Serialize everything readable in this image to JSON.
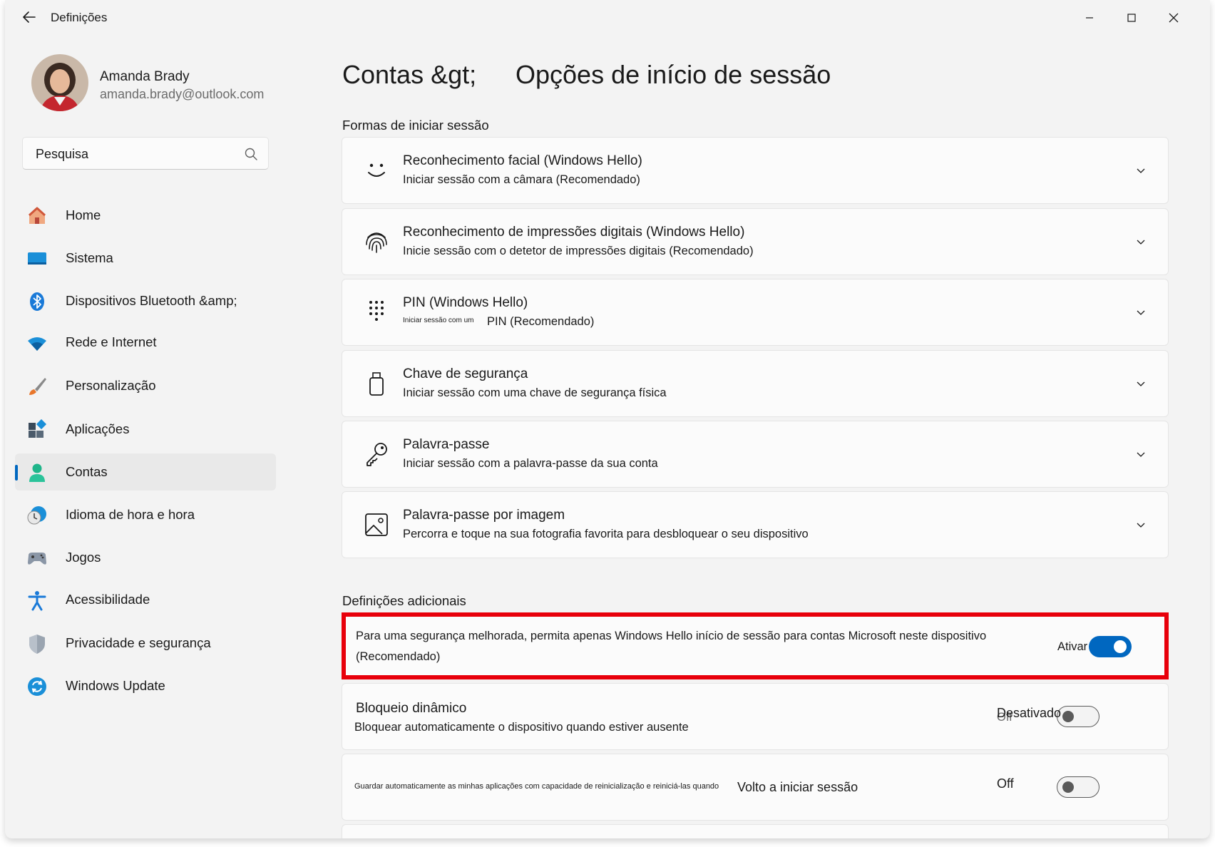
{
  "window": {
    "title": "Definições"
  },
  "user": {
    "name": "Amanda Brady",
    "email": "amanda.brady@outlook.com"
  },
  "search": {
    "placeholder": "Pesquisa"
  },
  "sidebar": {
    "items": [
      {
        "label": "Home",
        "icon": "home-icon"
      },
      {
        "label": "Sistema",
        "icon": "system-icon"
      },
      {
        "label": "Dispositivos Bluetooth &amp;",
        "icon": "bluetooth-icon"
      },
      {
        "label": "Rede e Internet",
        "icon": "wifi-icon"
      },
      {
        "label": "Personalização",
        "icon": "brush-icon"
      },
      {
        "label": "Aplicações",
        "icon": "apps-icon"
      },
      {
        "label": "Contas",
        "icon": "accounts-icon",
        "active": true
      },
      {
        "label": "Idioma de hora e hora",
        "icon": "time-language-icon"
      },
      {
        "label": "Jogos",
        "icon": "gaming-icon"
      },
      {
        "label": "Acessibilidade",
        "icon": "accessibility-icon"
      },
      {
        "label": "Privacidade e segurança",
        "icon": "shield-icon"
      },
      {
        "label": "Windows Update",
        "icon": "update-icon"
      }
    ]
  },
  "header": {
    "breadcrumb_parent": "Contas &gt;",
    "title": "Opções de início de sessão"
  },
  "sign_in_section": {
    "title": "Formas de iniciar sessão",
    "cards": [
      {
        "title": "Reconhecimento facial (Windows Hello)",
        "subtitle": "Iniciar sessão com a câmara (Recomendado)",
        "icon": "face-icon"
      },
      {
        "title": "Reconhecimento de impressões digitais (Windows Hello)",
        "subtitle": "Inicie sessão com o detetor de impressões digitais (Recomendado)",
        "icon": "fingerprint-icon"
      },
      {
        "title": "PIN (Windows Hello)",
        "subtitle_small": "Iniciar sessão com um",
        "subtitle": "PIN (Recomendado)",
        "icon": "pin-keypad-icon"
      },
      {
        "title": "Chave de segurança",
        "subtitle": "Iniciar sessão com uma chave de segurança física",
        "icon": "usb-key-icon"
      },
      {
        "title": "Palavra-passe",
        "subtitle": "Iniciar sessão com a palavra-passe da sua conta",
        "icon": "key-icon"
      },
      {
        "title": "Palavra-passe por imagem",
        "subtitle": "Percorra e toque na sua fotografia favorita para desbloquear o seu dispositivo",
        "icon": "picture-icon"
      }
    ]
  },
  "additional_section": {
    "title": "Definições adicionais",
    "hello_only": {
      "text": "Para uma segurança melhorada, permita apenas Windows Hello início de sessão para contas Microsoft neste dispositivo",
      "text2": "(Recomendado)",
      "state_label": "Ativar",
      "on": true
    },
    "dynamic_lock": {
      "title": "Bloqueio dinâmico",
      "subtitle": "Bloquear automaticamente o dispositivo quando estiver ausente",
      "state_label": "Desativado",
      "state_label_under": "Off",
      "on": false
    },
    "restart_apps": {
      "text_small": "Guardar automaticamente as minhas aplicações com capacidade de reinicialização e reiniciá-las quando",
      "text": "Volto a iniciar sessão",
      "state_label": "Off",
      "on": false
    }
  },
  "colors": {
    "accent": "#0067c0",
    "highlight": "#e8000b",
    "background": "#f3f3f3",
    "card": "#fbfbfb"
  }
}
